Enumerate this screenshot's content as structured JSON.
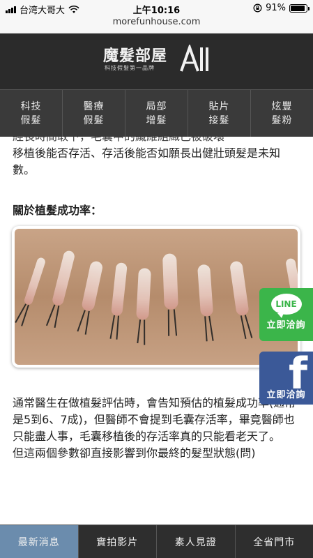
{
  "status_bar": {
    "carrier": "台湾大哥大",
    "time": "上午10:16",
    "battery": "91%",
    "battery_level": 0.91
  },
  "browser": {
    "url": "morefunhouse.com"
  },
  "header": {
    "logo_title": "魔髮部屋",
    "logo_subtitle": "科技假髮第一品牌",
    "logo_mark": "All"
  },
  "top_nav": [
    {
      "line1": "科技",
      "line2": "假髮"
    },
    {
      "line1": "醫療",
      "line2": "假髮"
    },
    {
      "line1": "局部",
      "line2": "增髮"
    },
    {
      "line1": "貼片",
      "line2": "接髮"
    },
    {
      "line1": "炫豐",
      "line2": "髮粉"
    }
  ],
  "article": {
    "paragraph_top_partial": "經長時間取下，毛囊中的纖維組織已被破壞",
    "paragraph_top": "移植後能否存活、存活後能否如願長出健壯頭髮是未知數。",
    "heading": "關於植髮成功率：",
    "paragraph_bottom_1": "通常醫生在做植髮評估時，會告知預估的植髮成功率(通常是5到6、7成)，但醫師不會提到毛囊存活率，畢竟醫師也只能盡人事，毛囊移植後的存活率真的只能看老天了。",
    "paragraph_bottom_2": "但這兩個參數卻直接影響到你最終的髮型狀態(問)"
  },
  "social": {
    "line_logo": "LINE",
    "line_label": "立即洽詢",
    "fb_logo": "f",
    "fb_label": "立即洽詢",
    "line_color": "#3bb54a",
    "fb_color": "#3b5998"
  },
  "bottom_nav": {
    "items": [
      "最新消息",
      "實拍影片",
      "素人見證",
      "全省門市"
    ],
    "active_index": 0,
    "active_color": "#6b8cad"
  }
}
